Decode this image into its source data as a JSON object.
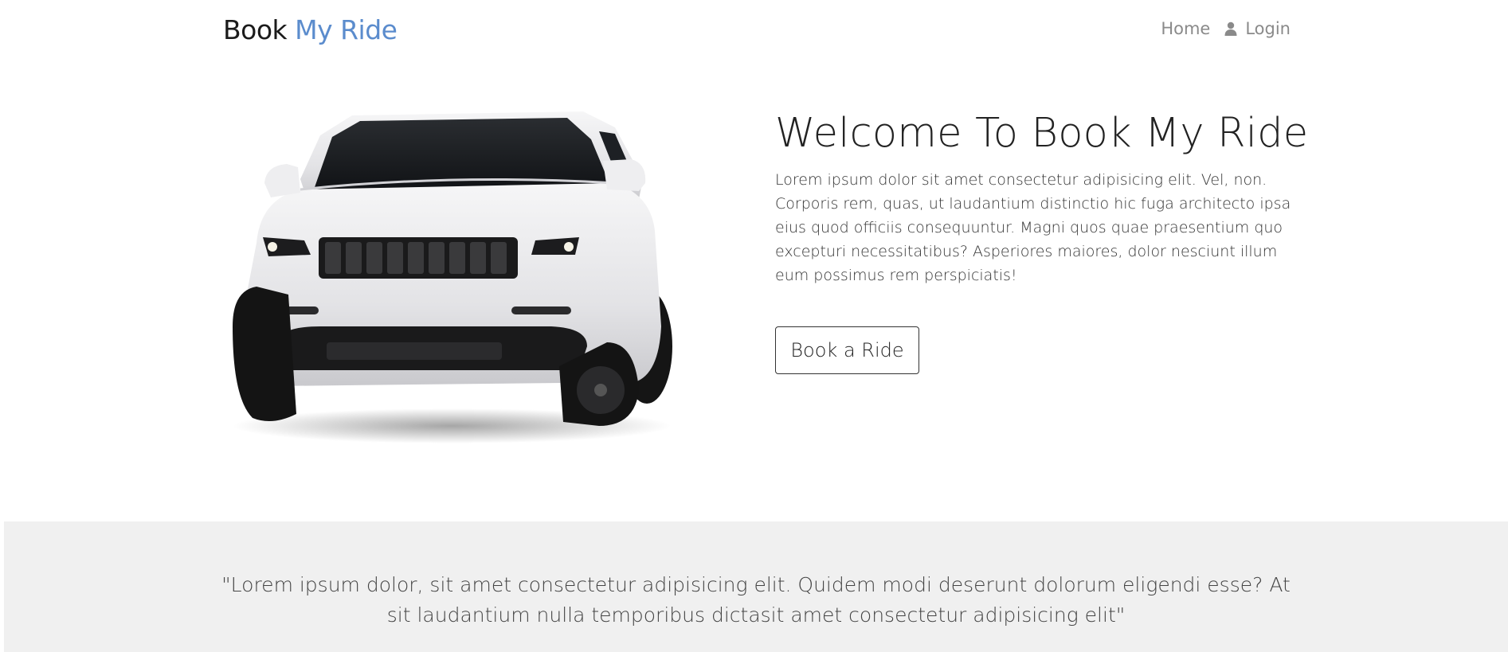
{
  "brand": {
    "part1": "Book",
    "part2": "My Ride",
    "accent_color": "#5b8ccd"
  },
  "nav": {
    "home_label": "Home",
    "login_label": "Login",
    "login_icon": "user-icon"
  },
  "hero": {
    "image_icon": "suv-car-image",
    "title": "Welcome To Book My Ride",
    "text": "Lorem ipsum dolor sit amet consectetur adipisicing elit. Vel, non. Corporis rem, quas, ut laudantium distinctio hic fuga architecto ipsa eius quod officiis consequuntur. Magni quos quae praesentium quo excepturi necessitatibus? Asperiores maiores, dolor nesciunt illum eum possimus rem perspiciatis!",
    "button_label": "Book a Ride"
  },
  "testimonial": {
    "quote": "\"Lorem ipsum dolor, sit amet consectetur adipisicing elit. Quidem modi deserunt dolorum eligendi esse? At sit laudantium nulla temporibus dictasit amet consectetur adipisicing elit\"",
    "background_color": "#f0f0f0"
  }
}
